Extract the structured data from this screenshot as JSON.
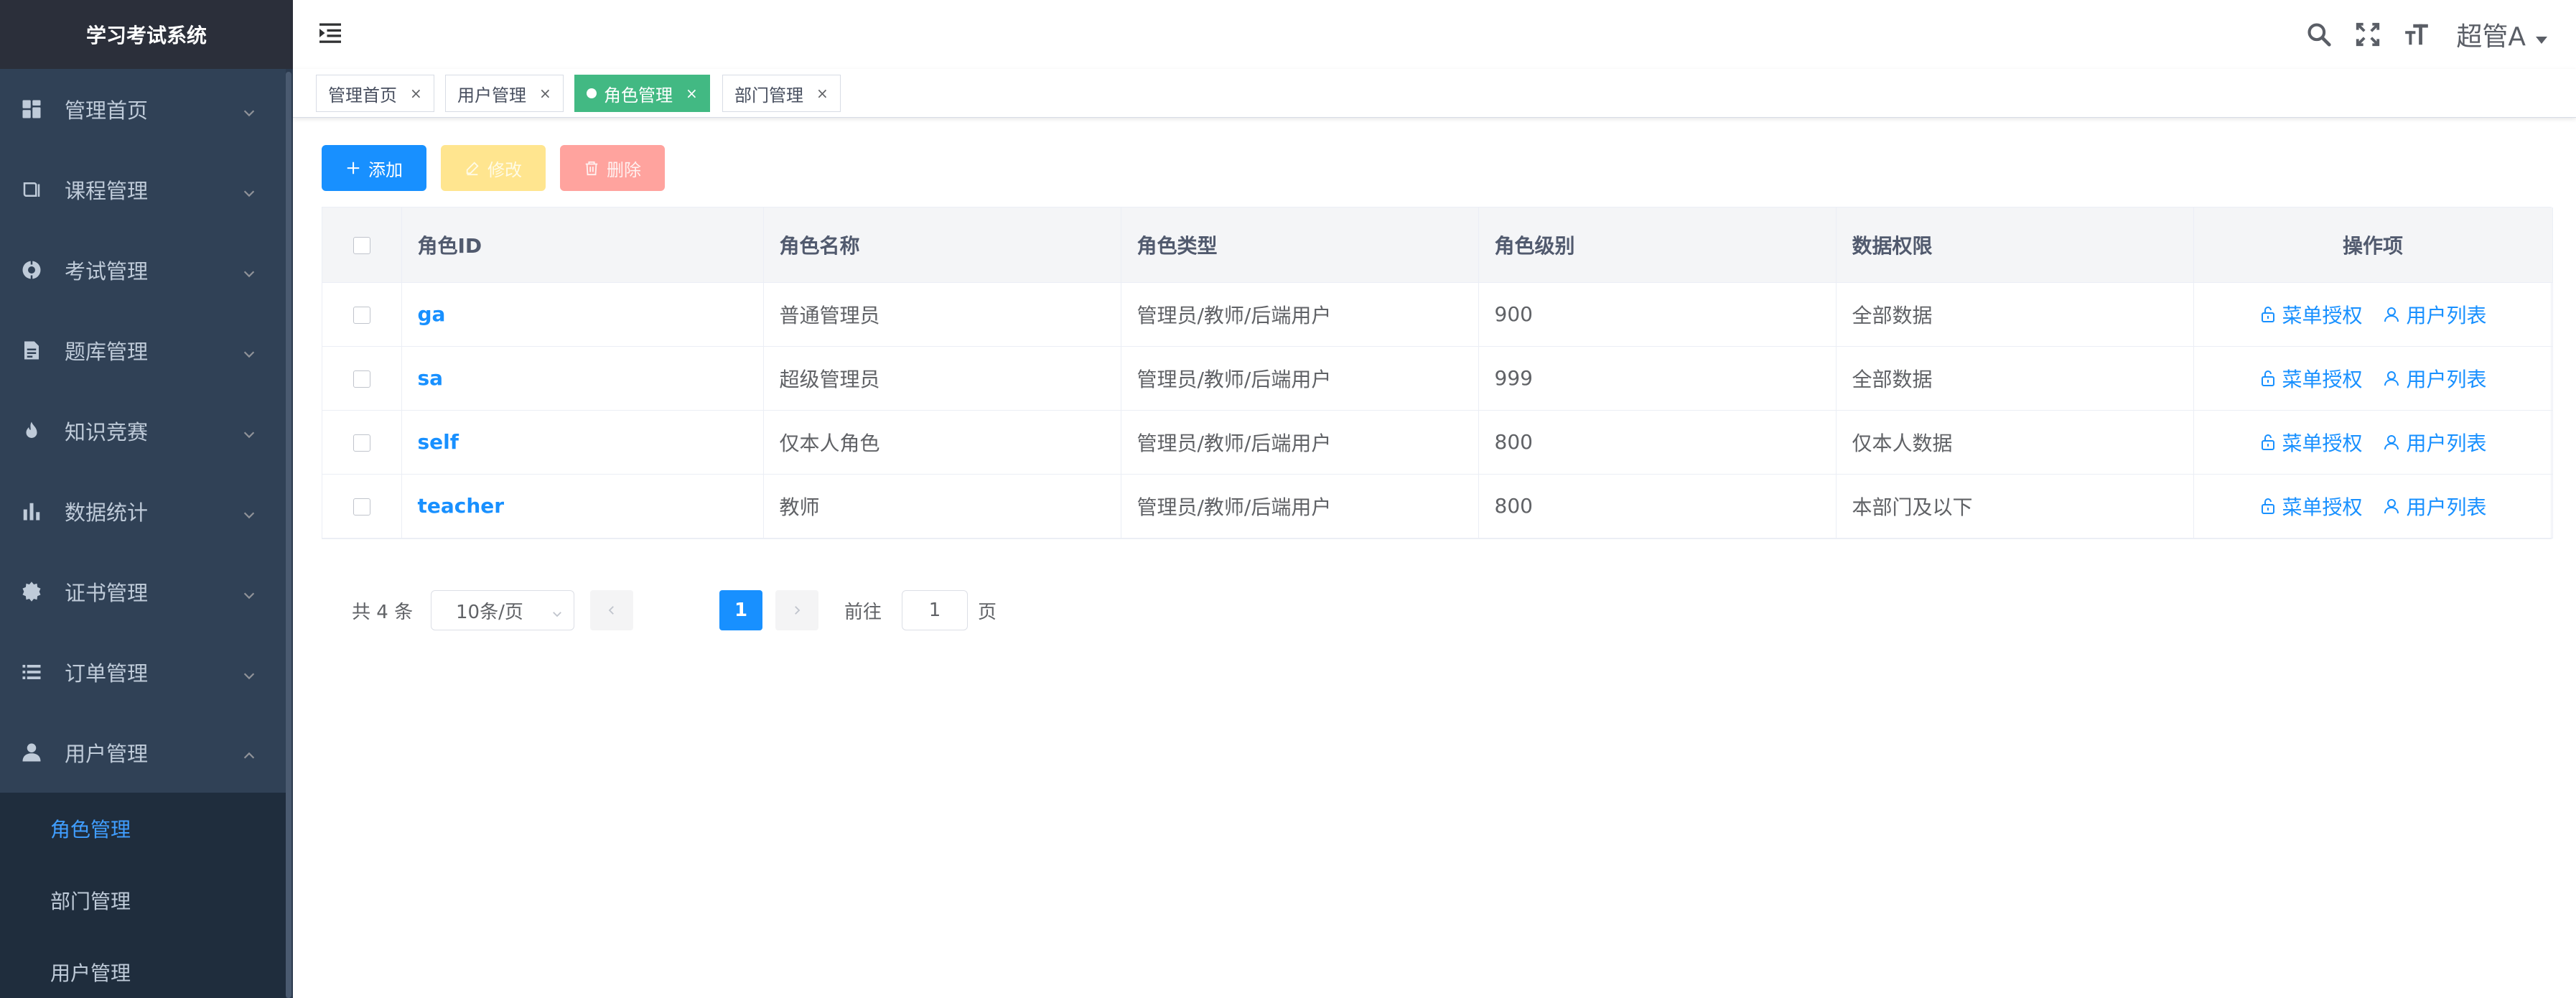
{
  "app": {
    "title": "学习考试系统"
  },
  "sidebar": {
    "items": [
      {
        "label": "管理首页",
        "icon": "dashboard-icon"
      },
      {
        "label": "课程管理",
        "icon": "book-icon"
      },
      {
        "label": "考试管理",
        "icon": "exam-icon"
      },
      {
        "label": "题库管理",
        "icon": "document-icon"
      },
      {
        "label": "知识竞赛",
        "icon": "fire-icon"
      },
      {
        "label": "数据统计",
        "icon": "chart-icon"
      },
      {
        "label": "证书管理",
        "icon": "badge-icon"
      },
      {
        "label": "订单管理",
        "icon": "list-icon"
      },
      {
        "label": "用户管理",
        "icon": "user-icon",
        "expanded": true
      }
    ],
    "submenu": [
      {
        "label": "角色管理",
        "active": true
      },
      {
        "label": "部门管理"
      },
      {
        "label": "用户管理"
      }
    ]
  },
  "header": {
    "user_name": "超管A"
  },
  "tags": [
    {
      "label": "管理首页",
      "close": "×"
    },
    {
      "label": "用户管理",
      "close": "×"
    },
    {
      "label": "角色管理",
      "close": "×",
      "active": true
    },
    {
      "label": "部门管理",
      "close": "×"
    }
  ],
  "toolbar": {
    "add_label": "添加",
    "edit_label": "修改",
    "delete_label": "删除"
  },
  "table": {
    "columns": [
      "角色ID",
      "角色名称",
      "角色类型",
      "角色级别",
      "数据权限",
      "操作项"
    ],
    "rows": [
      {
        "id": "ga",
        "name": "普通管理员",
        "type": "管理员/教师/后端用户",
        "level": "900",
        "scope": "全部数据"
      },
      {
        "id": "sa",
        "name": "超级管理员",
        "type": "管理员/教师/后端用户",
        "level": "999",
        "scope": "全部数据"
      },
      {
        "id": "self",
        "name": "仅本人角色",
        "type": "管理员/教师/后端用户",
        "level": "800",
        "scope": "仅本人数据"
      },
      {
        "id": "teacher",
        "name": "教师",
        "type": "管理员/教师/后端用户",
        "level": "800",
        "scope": "本部门及以下"
      }
    ],
    "actions": {
      "menu_auth": "菜单授权",
      "user_list": "用户列表"
    }
  },
  "pagination": {
    "total_text": "共 4 条",
    "page_size": "10条/页",
    "current_page": "1",
    "goto_label": "前往",
    "goto_value": "1",
    "goto_suffix": "页"
  },
  "colors": {
    "sidebar_bg": "#304156",
    "primary": "#1890ff",
    "active_tag": "#42b983",
    "edit_disabled": "#ffe58f",
    "delete_disabled": "#ffa39e"
  }
}
